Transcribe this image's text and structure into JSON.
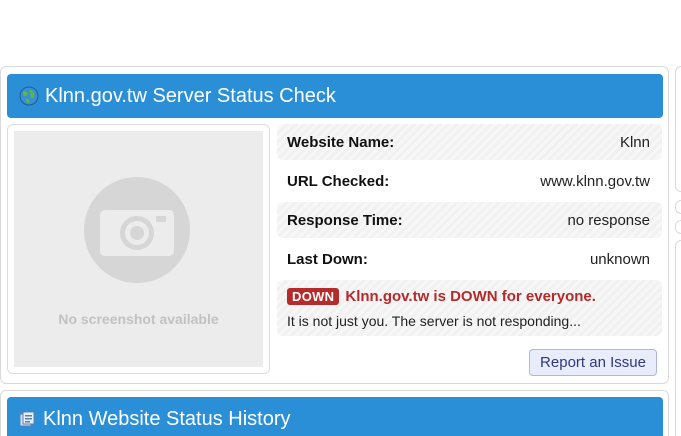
{
  "status_card": {
    "title": "Klnn.gov.tw Server Status Check",
    "icon": "globe-icon",
    "screenshot": {
      "caption": "No screenshot available",
      "icon": "camera-icon"
    },
    "info": {
      "website_name_label": "Website Name:",
      "website_name_value": "Klnn",
      "url_label": "URL Checked:",
      "url_value": "www.klnn.gov.tw",
      "response_label": "Response Time:",
      "response_value": "no response",
      "last_down_label": "Last Down:",
      "last_down_value": "unknown"
    },
    "status": {
      "badge": "DOWN",
      "message": "Klnn.gov.tw is DOWN for everyone.",
      "detail": "It is not just you. The server is not responding..."
    },
    "report_button": "Report an Issue"
  },
  "history_card": {
    "title": "Klnn Website Status History",
    "icon": "history-icon"
  },
  "colors": {
    "header_blue": "#2a8fd6",
    "down_red": "#b52a2a",
    "button_bg": "#e9ecfb"
  }
}
